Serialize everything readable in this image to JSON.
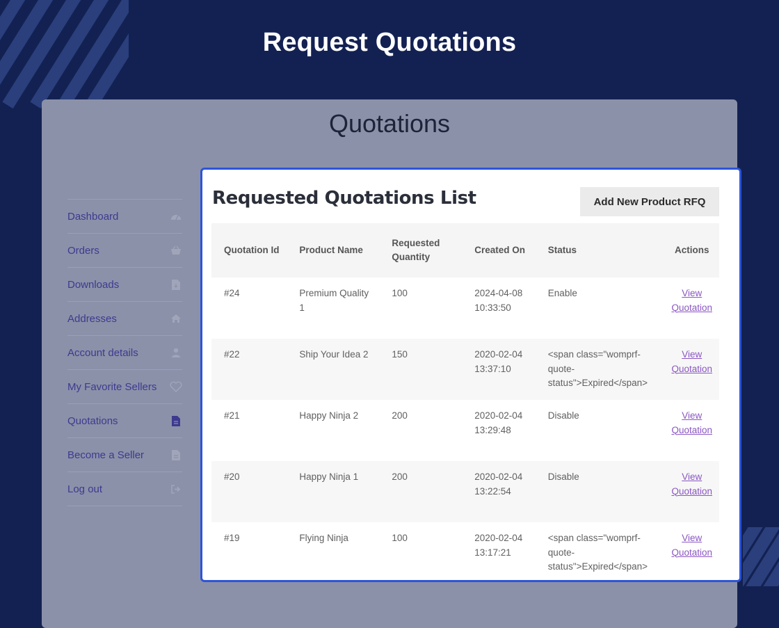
{
  "hero": {
    "title": "Request Quotations"
  },
  "panel": {
    "heading": "Quotations"
  },
  "nav": {
    "items": [
      {
        "label": "Dashboard",
        "icon": "dashboard-icon"
      },
      {
        "label": "Orders",
        "icon": "basket-icon"
      },
      {
        "label": "Downloads",
        "icon": "file-download-icon"
      },
      {
        "label": "Addresses",
        "icon": "home-icon"
      },
      {
        "label": "Account details",
        "icon": "user-icon"
      },
      {
        "label": "My Favorite Sellers",
        "icon": "heart-icon"
      },
      {
        "label": "Quotations",
        "icon": "file-icon"
      },
      {
        "label": "Become a Seller",
        "icon": "file-text-icon"
      },
      {
        "label": "Log out",
        "icon": "logout-icon"
      }
    ]
  },
  "card": {
    "title": "Requested Quotations List",
    "add_button_label": "Add New Product RFQ",
    "columns": {
      "id": "Quotation Id",
      "product": "Product Name",
      "quantity": "Requested Quantity",
      "created": "Created On",
      "status": "Status",
      "actions": "Actions"
    },
    "rows": [
      {
        "id": "#24",
        "product": "Premium Quality 1",
        "quantity": "100",
        "created": "2024-04-08 10:33:50",
        "status": "Enable",
        "action": "View Quotation"
      },
      {
        "id": "#22",
        "product": "Ship Your Idea 2",
        "quantity": "150",
        "created": "2020-02-04 13:37:10",
        "status": "<span class=\"womprf-quote-status\">Expired</span>",
        "action": "View Quotation"
      },
      {
        "id": "#21",
        "product": "Happy Ninja 2",
        "quantity": "200",
        "created": "2020-02-04 13:29:48",
        "status": "Disable",
        "action": "View Quotation"
      },
      {
        "id": "#20",
        "product": "Happy Ninja 1",
        "quantity": "200",
        "created": "2020-02-04 13:22:54",
        "status": "Disable",
        "action": "View Quotation"
      },
      {
        "id": "#19",
        "product": "Flying Ninja",
        "quantity": "100",
        "created": "2020-02-04 13:17:21",
        "status": "<span class=\"womprf-quote-status\">Expired</span>",
        "action": "View Quotation"
      }
    ]
  },
  "colors": {
    "page_background": "#132152",
    "panel_background": "#8b91a9",
    "card_border": "#2d54d8",
    "nav_text": "#3d3a8f",
    "link": "#8a56c2"
  }
}
